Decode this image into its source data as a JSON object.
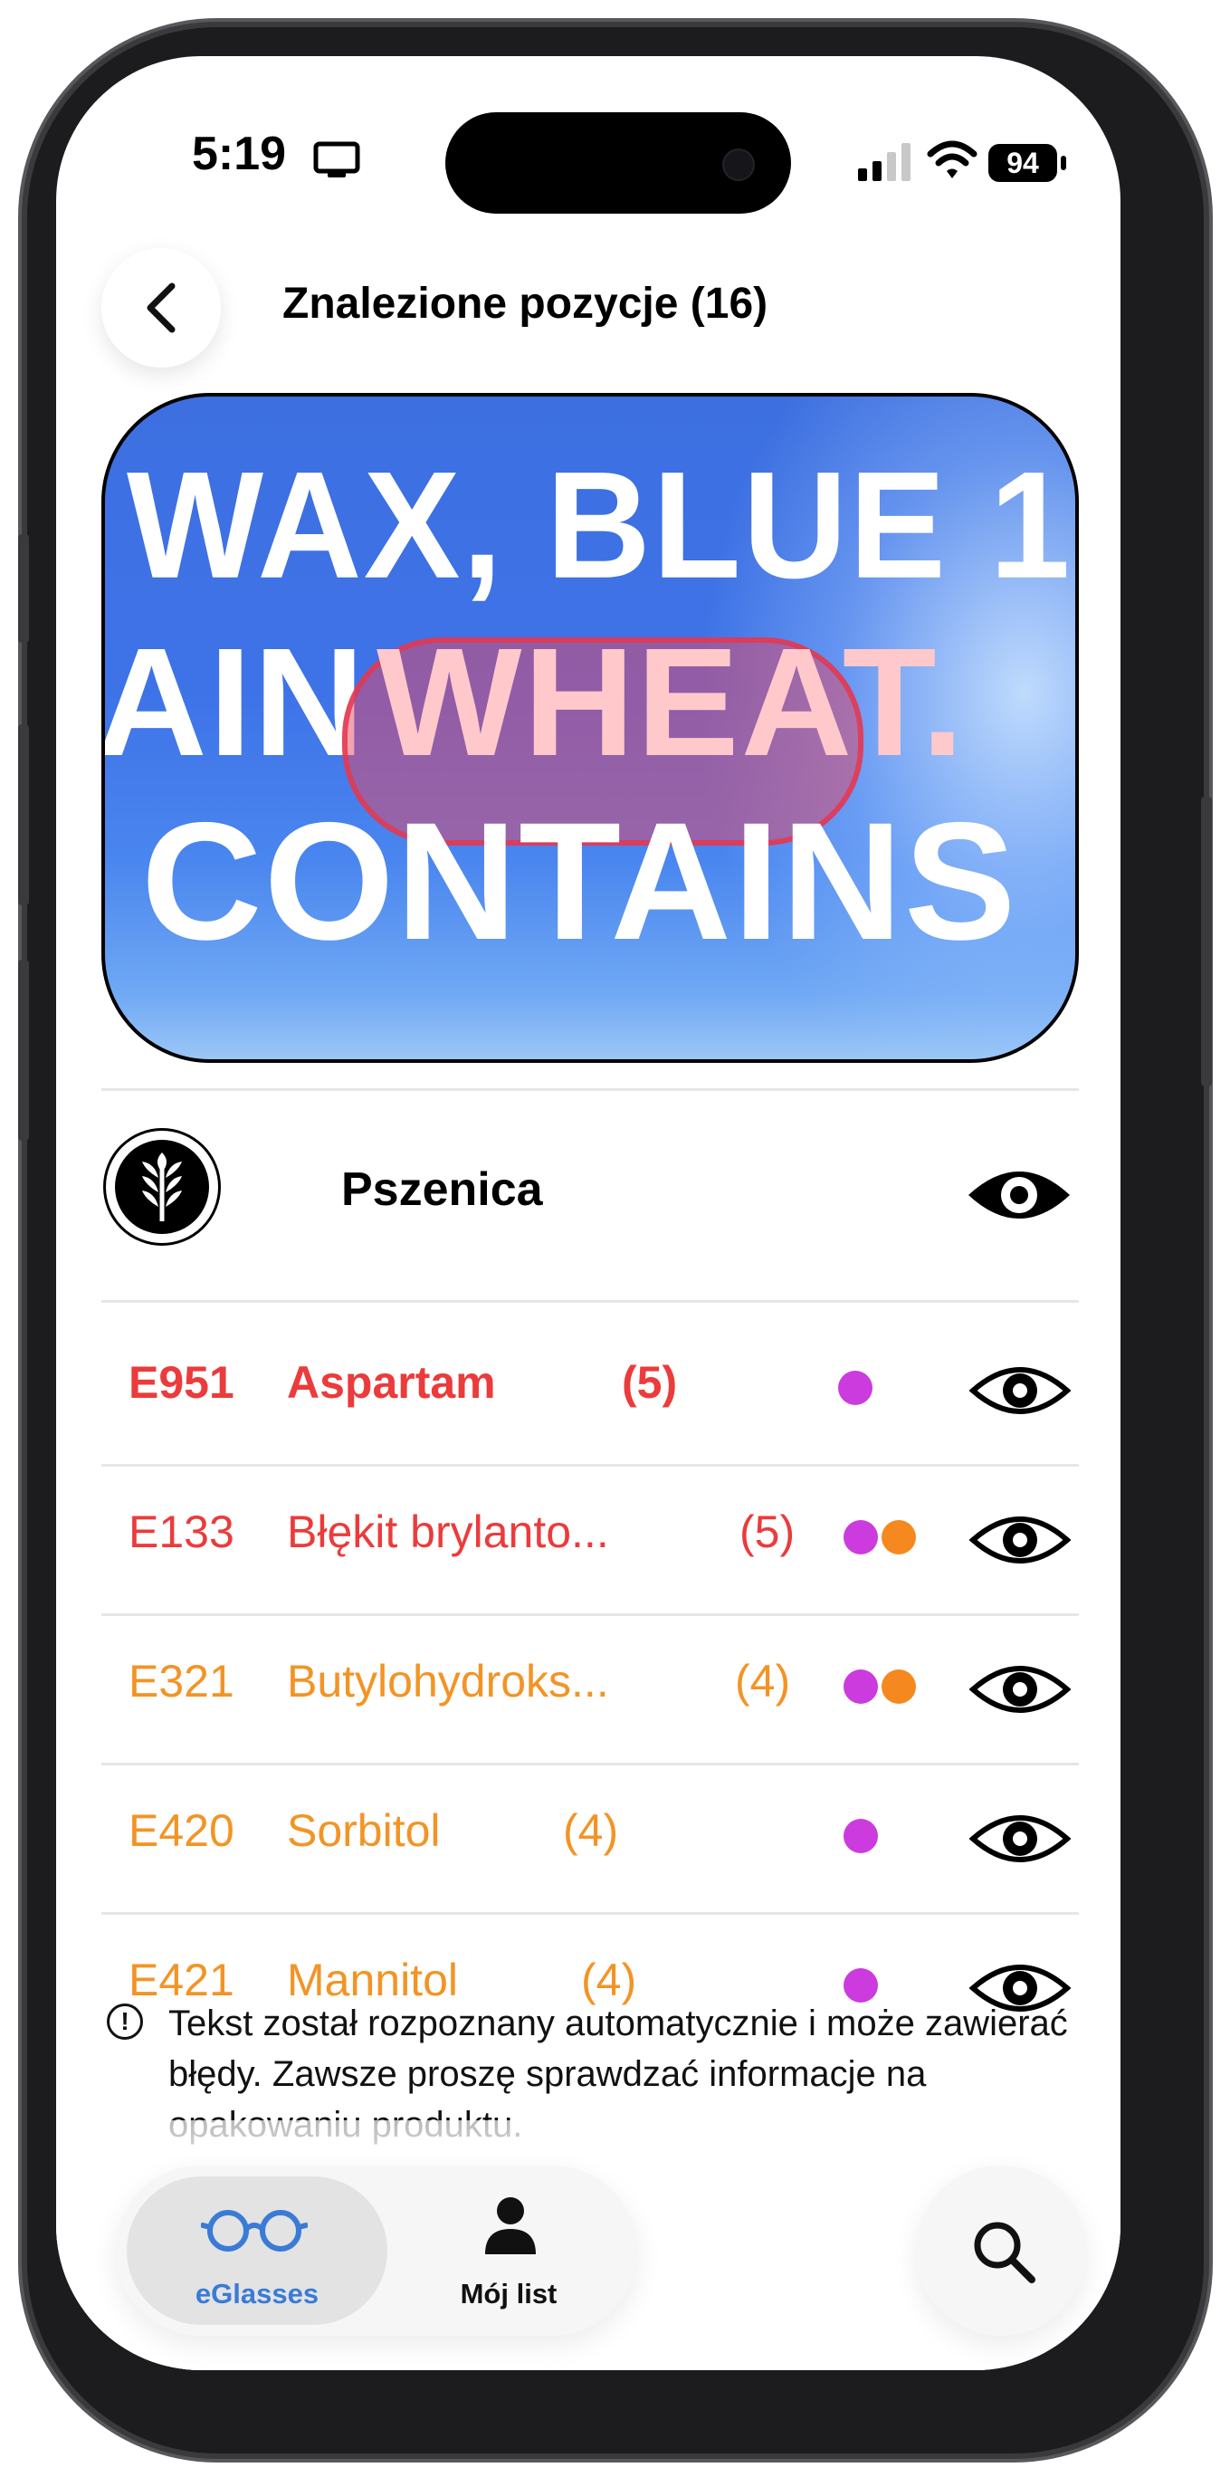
{
  "status_bar": {
    "time": "5:19",
    "battery": "94"
  },
  "header": {
    "title": "Znalezione pozycje (16)"
  },
  "scan_image": {
    "lines": [
      "WAX, BLUE 1",
      "AIN",
      "WHEAT.",
      "CONTAINS"
    ],
    "highlighted_word": "WHEAT."
  },
  "allergen": {
    "name": "Pszenica",
    "icon": "wheat-icon"
  },
  "colors": {
    "red": "#eb3b3b",
    "orange": "#f29425",
    "purple": "#cc3bdd",
    "dot_orange": "#f5891f",
    "tab_active": "#3a7bd5"
  },
  "items": [
    {
      "code": "E951",
      "name": "Aspartam",
      "count": "(5)",
      "color": "red",
      "bold": true,
      "dots": [
        "purple"
      ]
    },
    {
      "code": "E133",
      "name": "Błękit brylanto...",
      "count": "(5)",
      "color": "red",
      "bold": false,
      "dots": [
        "purple",
        "orange"
      ]
    },
    {
      "code": "E321",
      "name": "Butylohydroks...",
      "count": "(4)",
      "color": "orange",
      "bold": false,
      "dots": [
        "purple",
        "orange"
      ]
    },
    {
      "code": "E420",
      "name": "Sorbitol",
      "count": "(4)",
      "color": "orange",
      "bold": false,
      "dots": [
        "purple"
      ]
    },
    {
      "code": "E421",
      "name": "Mannitol",
      "count": "(4)",
      "color": "orange",
      "bold": false,
      "dots": [
        "purple"
      ]
    }
  ],
  "disclaimer": "Tekst został rozpoznany automatycznie i może zawierać błędy. Zawsze proszę sprawdzać informacje na opakowaniu produktu.",
  "tabs": [
    {
      "label": "eGlasses",
      "icon": "glasses-icon",
      "active": true
    },
    {
      "label": "Mój list",
      "icon": "person-icon",
      "active": false
    }
  ],
  "search": {
    "icon": "search-icon"
  }
}
